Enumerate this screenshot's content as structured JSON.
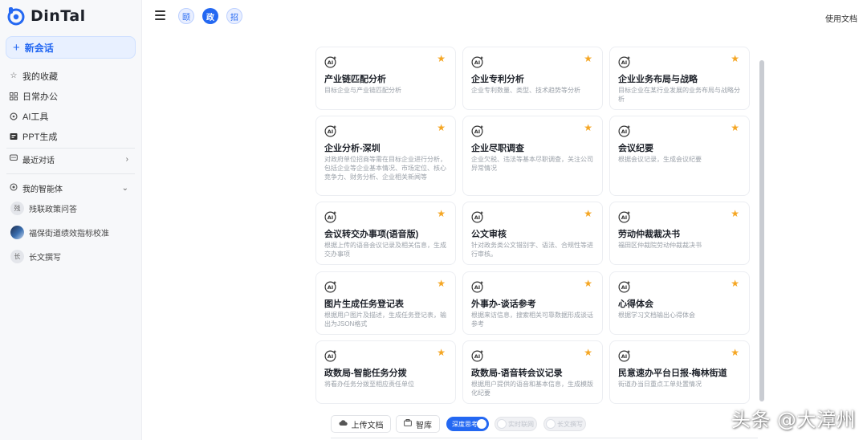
{
  "app": {
    "logo_text": "DinTal",
    "brand_color": "#2468f2"
  },
  "sidebar": {
    "new_chat_label": "新会话",
    "nav": [
      {
        "label": "我的收藏",
        "icon": "star-outline-icon"
      },
      {
        "label": "日常办公",
        "icon": "grid-icon"
      },
      {
        "label": "AI工具",
        "icon": "ai-tool-icon"
      },
      {
        "label": "PPT生成",
        "icon": "ppt-icon"
      }
    ],
    "recent_label": "最近对话",
    "agents_label": "我的智能体",
    "agents": [
      {
        "avatar": "残",
        "label": "残联政策问答"
      },
      {
        "avatar": "",
        "label": "福保街道绩效指标校准"
      },
      {
        "avatar": "长",
        "label": "长文撰写"
      }
    ]
  },
  "header": {
    "chips": [
      "颐",
      "政",
      "招"
    ],
    "docs_link": "使用文档"
  },
  "cards": [
    {
      "title": "产业链匹配分析",
      "desc": "目标企业与产业链匹配分析"
    },
    {
      "title": "企业专利分析",
      "desc": "企业专利数量、类型、技术趋势等分析"
    },
    {
      "title": "企业业务布局与战略",
      "desc": "目标企业在某行业发展的业务布局与战略分析"
    },
    {
      "title": "企业分析-深圳",
      "desc": "对政府单位招商等需在目标企业进行分析，包括企业等企业基本情况、市场定位、核心竞争力、财务分析、企业相关新闻等"
    },
    {
      "title": "企业尽职调查",
      "desc": "企业欠税、违法等基本尽职调查，关注公司异常情况"
    },
    {
      "title": "会议纪要",
      "desc": "根据会议记录，生成会议纪要"
    },
    {
      "title": "会议转交办事项(语音版)",
      "desc": "根据上传的语音会议记录及相关信息，生成交办事项"
    },
    {
      "title": "公文审核",
      "desc": "针对政务类公文错别字、语法、合规性等进行审核。"
    },
    {
      "title": "劳动仲裁裁决书",
      "desc": "福田区仲裁院劳动仲裁裁决书"
    },
    {
      "title": "图片生成任务登记表",
      "desc": "根据用户图片及描述，生成任务登记表，输出为JSON格式"
    },
    {
      "title": "外事办-谈话参考",
      "desc": "根据来访信息，搜索相关可靠数据形成谈话参考"
    },
    {
      "title": "心得体会",
      "desc": "根据学习文档输出心得体会"
    },
    {
      "title": "政数局-智能任务分拨",
      "desc": "将看办任务分拨至相应责任单位"
    },
    {
      "title": "政数局-语音转会议记录",
      "desc": "根据用户提供的语音和基本信息，生成模版化纪要"
    },
    {
      "title": "民意速办平台日报-梅林街道",
      "desc": "街道办当日重点工单处置情况"
    }
  ],
  "bottom": {
    "upload_label": "上传文档",
    "library_label": "智库",
    "toggles": [
      {
        "label": "深度思考",
        "on": true
      },
      {
        "label": "实时联网",
        "on": false
      },
      {
        "label": "长文撰写",
        "on": false
      }
    ]
  },
  "watermark": "头条 @大漳州"
}
